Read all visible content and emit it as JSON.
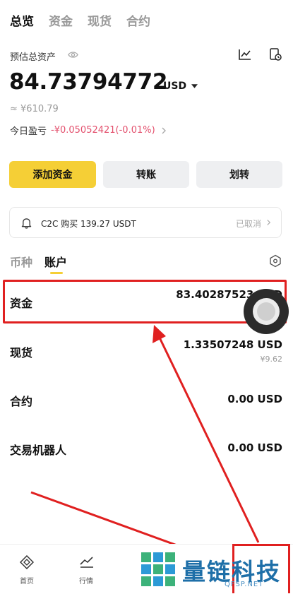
{
  "top_tabs": [
    "总览",
    "资金",
    "现货",
    "合约"
  ],
  "header": {
    "estimated_label": "预估总资产",
    "balance": "84.73794772",
    "currency": "USD",
    "cny_value": "≈ ¥610.79",
    "pnl_label": "今日盈亏",
    "pnl_value": "-¥0.05052421(-0.01%)"
  },
  "actions": {
    "deposit": "添加资金",
    "transfer": "转账",
    "move": "划转"
  },
  "notice": {
    "text": "C2C 购买 139.27 USDT",
    "status": "已取消"
  },
  "sub_tabs": [
    "币种",
    "账户"
  ],
  "accounts": [
    {
      "name": "资金",
      "amount": "83.40287523 USD",
      "sub": ""
    },
    {
      "name": "现货",
      "amount": "1.33507248 USD",
      "sub": "¥9.62"
    },
    {
      "name": "合约",
      "amount": "0.00 USD",
      "sub": ""
    },
    {
      "name": "交易机器人",
      "amount": "0.00 USD",
      "sub": ""
    }
  ],
  "bottom_nav": [
    "首页",
    "行情"
  ],
  "watermark": {
    "text": "量链科技",
    "sub": "QFSP.NET"
  },
  "colors": {
    "accent": "#f5cf36",
    "negative": "#e3506d",
    "highlight": "#e02020"
  },
  "icons": [
    "eye-icon",
    "chart-icon",
    "history-icon",
    "caret-down-icon",
    "chevron-right-icon",
    "bell-icon",
    "hexagon-settings-icon",
    "home-icon",
    "market-icon"
  ]
}
